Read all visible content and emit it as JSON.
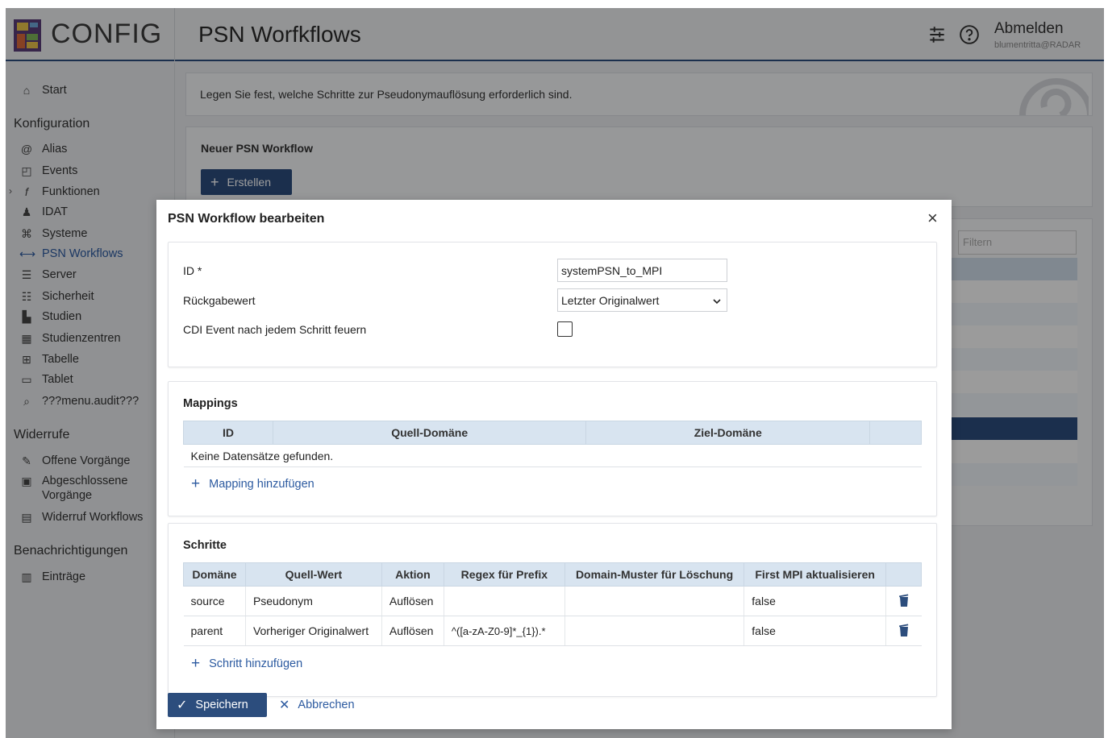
{
  "app": {
    "logo_text": "CONFIG",
    "page_title": "PSN Worfkflows",
    "logout_label": "Abmelden",
    "user": "blumentritta@RADAR"
  },
  "sidebar": {
    "start": "Start",
    "sec_konfiguration": "Konfiguration",
    "items": [
      "Alias",
      "Events",
      "Funktionen",
      "IDAT",
      "Systeme",
      "PSN Workflows",
      "Server",
      "Sicherheit",
      "Studien",
      "Studienzentren",
      "Tabelle",
      "Tablet",
      "???menu.audit???"
    ],
    "sec_widerrufe": "Widerrufe",
    "widerrufe": [
      "Offene Vorgänge",
      "Abgeschlossene",
      "Vorgänge",
      "Widerruf Workflows"
    ],
    "sec_benachrichtigungen": "Benachrichtigungen",
    "benachrichtigungen": [
      "Einträge"
    ]
  },
  "background": {
    "info_text": "Legen Sie fest, welche Schritte zur Pseudonymauflösung erforderlich sind.",
    "new_title": "Neuer PSN Workflow",
    "create_label": "Erstellen",
    "filter_placeholder": "Filtern"
  },
  "modal": {
    "title": "PSN Workflow bearbeiten",
    "close": "×",
    "form": {
      "id_label": "ID *",
      "id_value": "systemPSN_to_MPI",
      "return_label": "Rückgabewert",
      "return_value": "Letzter Originalwert",
      "cdi_label": "CDI Event nach jedem Schritt feuern",
      "cdi_checked": false
    },
    "mappings": {
      "title": "Mappings",
      "columns": [
        "ID",
        "Quell-Domäne",
        "Ziel-Domäne",
        ""
      ],
      "empty": "Keine Datensätze gefunden.",
      "add_label": "Mapping hinzufügen"
    },
    "steps": {
      "title": "Schritte",
      "columns": [
        "Domäne",
        "Quell-Wert",
        "Aktion",
        "Regex für Prefix",
        "Domain-Muster für Löschung",
        "First MPI aktualisieren",
        ""
      ],
      "rows": [
        {
          "domain": "source",
          "source_value": "Pseudonym",
          "action": "Auflösen",
          "regex": "",
          "pattern": "",
          "first_mpi": "false"
        },
        {
          "domain": "parent",
          "source_value": "Vorheriger Originalwert",
          "action": "Auflösen",
          "regex": "^([a-zA-Z0-9]*_{1}).*",
          "pattern": "",
          "first_mpi": "false"
        }
      ],
      "add_label": "Schritt hinzufügen"
    },
    "save_label": "Speichern",
    "cancel_label": "Abbrechen"
  }
}
